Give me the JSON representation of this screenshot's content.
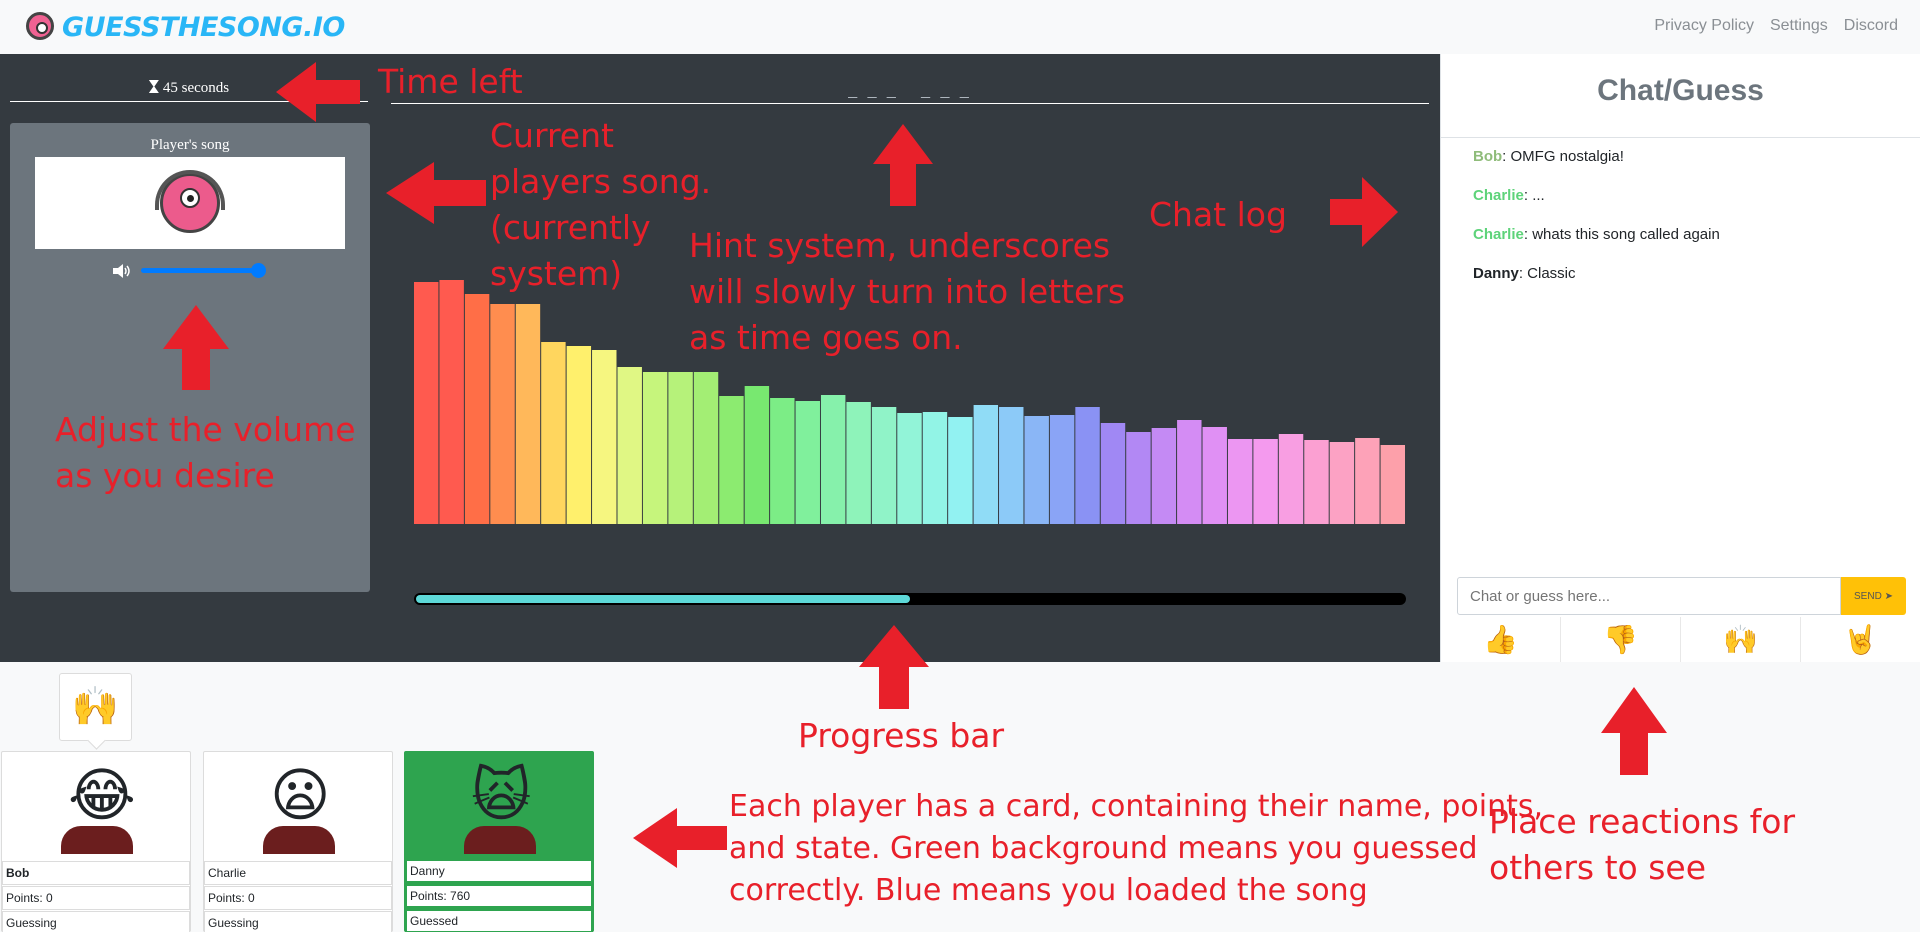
{
  "navbar": {
    "logo_text": "GUESSTHESONG.IO",
    "links": [
      "Privacy Policy",
      "Settings",
      "Discord"
    ]
  },
  "game": {
    "timer": "45 seconds",
    "hint": "_ _ _   _ _ _",
    "song_title": "Player's song",
    "volume": 0.85,
    "progress": 0.5,
    "visualizer_bars": [
      {
        "h": 242,
        "c": "#ff5a4f"
      },
      {
        "h": 244,
        "c": "#ff5a4f"
      },
      {
        "h": 230,
        "c": "#ff6e47"
      },
      {
        "h": 220,
        "c": "#ff8d4f"
      },
      {
        "h": 220,
        "c": "#ffb85a"
      },
      {
        "h": 182,
        "c": "#ffd65e"
      },
      {
        "h": 178,
        "c": "#fff06c"
      },
      {
        "h": 174,
        "c": "#f6f680"
      },
      {
        "h": 157,
        "c": "#e0f784"
      },
      {
        "h": 152,
        "c": "#c6f57c"
      },
      {
        "h": 152,
        "c": "#b6f27a"
      },
      {
        "h": 152,
        "c": "#a3ee74"
      },
      {
        "h": 128,
        "c": "#8ceb70"
      },
      {
        "h": 138,
        "c": "#78e870"
      },
      {
        "h": 126,
        "c": "#7ced86"
      },
      {
        "h": 123,
        "c": "#80f09c"
      },
      {
        "h": 129,
        "c": "#86f1ab"
      },
      {
        "h": 122,
        "c": "#8ef3ba"
      },
      {
        "h": 117,
        "c": "#90f3c8"
      },
      {
        "h": 111,
        "c": "#92f4d8"
      },
      {
        "h": 112,
        "c": "#92f4e6"
      },
      {
        "h": 107,
        "c": "#92f2f2"
      },
      {
        "h": 119,
        "c": "#90dcf6"
      },
      {
        "h": 117,
        "c": "#8ccaf8"
      },
      {
        "h": 108,
        "c": "#8ab6f6"
      },
      {
        "h": 109,
        "c": "#8aa4f6"
      },
      {
        "h": 117,
        "c": "#8a92f4"
      },
      {
        "h": 101,
        "c": "#a088f4"
      },
      {
        "h": 92,
        "c": "#b288f4"
      },
      {
        "h": 96,
        "c": "#c48af4"
      },
      {
        "h": 104,
        "c": "#d48cf4"
      },
      {
        "h": 97,
        "c": "#e090f4"
      },
      {
        "h": 85,
        "c": "#ec96f2"
      },
      {
        "h": 85,
        "c": "#f49aee"
      },
      {
        "h": 90,
        "c": "#f89ee2"
      },
      {
        "h": 84,
        "c": "#fba0d2"
      },
      {
        "h": 82,
        "c": "#fca2c4"
      },
      {
        "h": 86,
        "c": "#fda2b8"
      },
      {
        "h": 79,
        "c": "#fda0aa"
      }
    ]
  },
  "chat": {
    "title": "Chat/Guess",
    "messages": [
      {
        "user": "Bob",
        "text": ": OMFG nostalgia!",
        "color": "#8fbc7a"
      },
      {
        "user": "Charlie",
        "text": ": ...",
        "color": "#5ed37a"
      },
      {
        "user": "Charlie",
        "text": ": whats this song called again",
        "color": "#5ed37a"
      },
      {
        "user": "Danny",
        "text": ": Classic",
        "color": "#212529"
      }
    ],
    "input_placeholder": "Chat or guess here...",
    "send_label": "SEND",
    "reactions": [
      "👍",
      "👎",
      "🙌",
      "🤘"
    ]
  },
  "players": [
    {
      "name": "Bob",
      "points": "Points: 0",
      "state": "Guessing",
      "face": "😂",
      "bubble": "🙌",
      "status_color": "#ffffff"
    },
    {
      "name": "Charlie",
      "points": "Points: 0",
      "state": "Guessing",
      "face": "😦",
      "status_color": "#ffffff"
    },
    {
      "name": "Danny",
      "points": "Points: 760",
      "state": "Guessed",
      "face": "🙀",
      "status_color": "#2ea44f"
    }
  ],
  "annotations": {
    "time_left": "Time left",
    "current_song": "Current\nplayers song.\n(currently\nsystem)",
    "hint_system": "Hint system, underscores\nwill slowly turn into letters\nas time goes on.",
    "chat_log": "Chat log",
    "volume": "Adjust the volume\nas you desire",
    "progress_bar": "Progress bar",
    "player_card": "Each player has a card, containing their name, points,\nand state. Green background means you guessed\ncorrectly. Blue means you loaded the song",
    "reactions": "Place reactions for\nothers to see"
  },
  "colors": {
    "annotation": "#e8202a",
    "accent": "#007bff",
    "send": "#ffc107",
    "guessed": "#2ea44f"
  }
}
